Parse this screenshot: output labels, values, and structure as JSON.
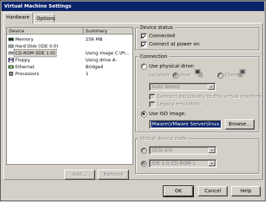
{
  "window": {
    "title": "Virtual Machine Settings"
  },
  "tabs": [
    {
      "label": "Hardware",
      "active": true
    },
    {
      "label": "Options",
      "active": false
    }
  ],
  "device_list": {
    "columns": [
      "Device",
      "Summary"
    ],
    "rows": [
      {
        "device": "Memory",
        "summary": "256 MB",
        "icon": "memory-icon"
      },
      {
        "device": "Hard Disk (IDE 0:0)",
        "summary": "",
        "icon": "hard-disk-icon"
      },
      {
        "device": "CD-ROM (IDE 1:0)",
        "summary": "Using image C:\\Pr...",
        "icon": "cdrom-icon",
        "selected": true
      },
      {
        "device": "Floppy",
        "summary": "Using drive A:",
        "icon": "floppy-icon"
      },
      {
        "device": "Ethernet",
        "summary": "Bridged",
        "icon": "ethernet-icon"
      },
      {
        "device": "Processors",
        "summary": "1",
        "icon": "processor-icon"
      }
    ]
  },
  "list_buttons": {
    "add": "Add...",
    "remove": "Remove"
  },
  "device_status": {
    "title": "Device status",
    "connected": {
      "label": "Connected",
      "checked": true
    },
    "connect_at_power_on": {
      "label": "Connect at power on",
      "checked": true
    }
  },
  "connection": {
    "title": "Connection",
    "physical": {
      "label": "Use physical drive:",
      "selected": false
    },
    "location_label": "Location:",
    "host_label": "Host",
    "client_label": "Client",
    "drive_value": "Auto detect",
    "exclusive": {
      "label": "Connect exclusively to this virtual machine",
      "checked": false
    },
    "legacy": {
      "label": "Legacy emulation",
      "checked": false
    },
    "iso": {
      "label": "Use ISO image:",
      "selected": true
    },
    "iso_path": "Mware\\VMware Server\\linux.iso",
    "browse_label": "Browse..."
  },
  "virtual_device_node": {
    "title": "Virtual device node",
    "scsi": {
      "value": "SCSI 0:0"
    },
    "ide": {
      "value": "IDE 1:0  CD-ROM 1"
    }
  },
  "footer": {
    "ok": "OK",
    "cancel": "Cancel",
    "help": "Help"
  },
  "colors": {
    "titlebar": "#0a246a",
    "face": "#d4d0c8",
    "selection": "#0a246a"
  }
}
